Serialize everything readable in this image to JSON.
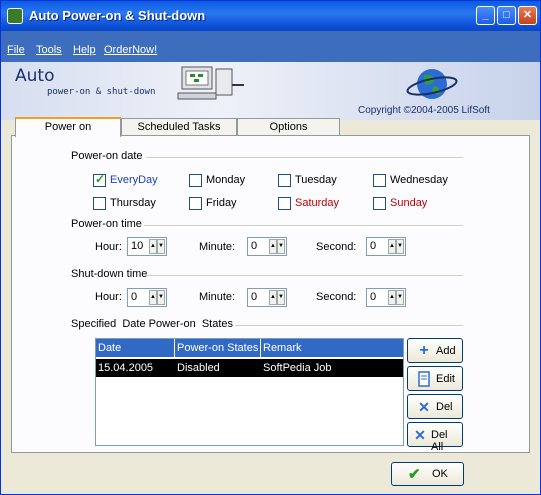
{
  "window": {
    "title": "Auto Power-on & Shut-down",
    "minimize": "_",
    "maximize": "□",
    "close": "✕"
  },
  "menu": [
    "File",
    "Tools",
    "Help",
    "OrderNow!"
  ],
  "banner": {
    "logo_main": "Auto",
    "logo_sub": "power-on & shut-down",
    "copyright": "Copyright ©2004-2005 LifSoft"
  },
  "tabs": [
    "Power on",
    "Scheduled Tasks",
    "Options"
  ],
  "power_on_date": {
    "label": "Power-on date",
    "days": [
      {
        "label": "EveryDay",
        "checked": true,
        "color": "#1d3fbf"
      },
      {
        "label": "Monday",
        "checked": false,
        "color": "#000000"
      },
      {
        "label": "Tuesday",
        "checked": false,
        "color": "#000000"
      },
      {
        "label": "Wednesday",
        "checked": false,
        "color": "#000000"
      },
      {
        "label": "Thursday",
        "checked": false,
        "color": "#000000"
      },
      {
        "label": "Friday",
        "checked": false,
        "color": "#000000"
      },
      {
        "label": "Saturday",
        "checked": false,
        "color": "#c00000"
      },
      {
        "label": "Sunday",
        "checked": false,
        "color": "#c00000"
      }
    ]
  },
  "power_on_time": {
    "label": "Power-on time",
    "hour_label": "Hour:",
    "hour": "10",
    "minute_label": "Minute:",
    "minute": "0",
    "second_label": "Second:",
    "second": "0"
  },
  "shutdown_time": {
    "label": "Shut-down time",
    "hour_label": "Hour:",
    "hour": "0",
    "minute_label": "Minute:",
    "minute": "0",
    "second_label": "Second:",
    "second": "0"
  },
  "states": {
    "label": "Specified  Date Power-on  States",
    "columns": [
      "Date",
      "Power-on States",
      "Remark"
    ],
    "rows": [
      [
        "15.04.2005",
        "Disabled",
        "SoftPedia Job"
      ]
    ],
    "buttons": {
      "add": "Add",
      "edit": "Edit",
      "del": "Del",
      "del_all": "Del All"
    }
  },
  "ok_label": "OK",
  "colors": {
    "titlebar": "#0a5be2",
    "menubar": "#3d6dbd",
    "selection": "#316ac5"
  }
}
